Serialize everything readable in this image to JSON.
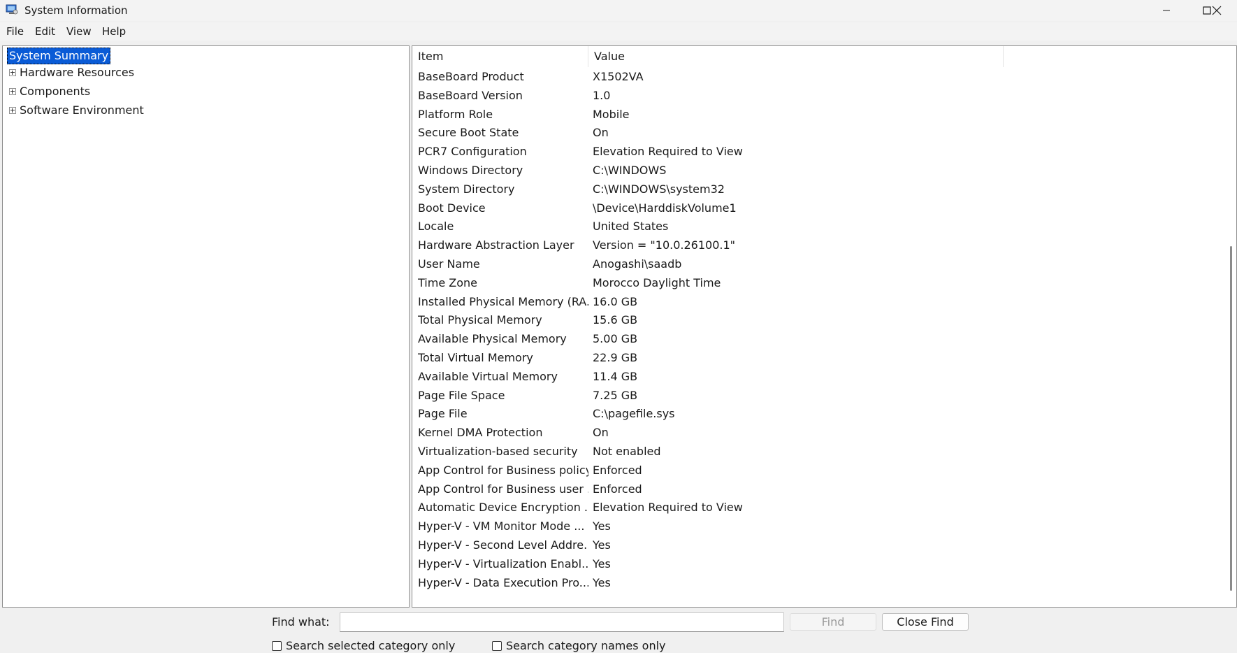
{
  "window": {
    "title": "System Information"
  },
  "menu": [
    "File",
    "Edit",
    "View",
    "Help"
  ],
  "tree": {
    "root": "System Summary",
    "children": [
      "Hardware Resources",
      "Components",
      "Software Environment"
    ]
  },
  "list": {
    "columns": [
      "Item",
      "Value"
    ],
    "rows": [
      [
        "BaseBoard Product",
        "X1502VA"
      ],
      [
        "BaseBoard Version",
        "1.0"
      ],
      [
        "Platform Role",
        "Mobile"
      ],
      [
        "Secure Boot State",
        "On"
      ],
      [
        "PCR7 Configuration",
        "Elevation Required to View"
      ],
      [
        "Windows Directory",
        "C:\\WINDOWS"
      ],
      [
        "System Directory",
        "C:\\WINDOWS\\system32"
      ],
      [
        "Boot Device",
        "\\Device\\HarddiskVolume1"
      ],
      [
        "Locale",
        "United States"
      ],
      [
        "Hardware Abstraction Layer",
        "Version = \"10.0.26100.1\""
      ],
      [
        "User Name",
        "Anogashi\\saadb"
      ],
      [
        "Time Zone",
        "Morocco Daylight Time"
      ],
      [
        "Installed Physical Memory (RA...",
        "16.0 GB"
      ],
      [
        "Total Physical Memory",
        "15.6 GB"
      ],
      [
        "Available Physical Memory",
        "5.00 GB"
      ],
      [
        "Total Virtual Memory",
        "22.9 GB"
      ],
      [
        "Available Virtual Memory",
        "11.4 GB"
      ],
      [
        "Page File Space",
        "7.25 GB"
      ],
      [
        "Page File",
        "C:\\pagefile.sys"
      ],
      [
        "Kernel DMA Protection",
        "On"
      ],
      [
        "Virtualization-based security",
        "Not enabled"
      ],
      [
        "App Control for Business policy",
        "Enforced"
      ],
      [
        "App Control for Business user ...",
        "Enforced"
      ],
      [
        "Automatic Device Encryption ...",
        "Elevation Required to View"
      ],
      [
        "Hyper-V - VM Monitor Mode ...",
        "Yes"
      ],
      [
        "Hyper-V - Second Level Addre...",
        "Yes"
      ],
      [
        "Hyper-V - Virtualization Enabl...",
        "Yes"
      ],
      [
        "Hyper-V - Data Execution Pro...",
        "Yes"
      ]
    ]
  },
  "find": {
    "label": "Find what:",
    "value": "",
    "find_button": "Find",
    "close_button": "Close Find",
    "option1": "Search selected category only",
    "option2": "Search category names only"
  },
  "colors": {
    "selection": "#0a5bd6"
  }
}
